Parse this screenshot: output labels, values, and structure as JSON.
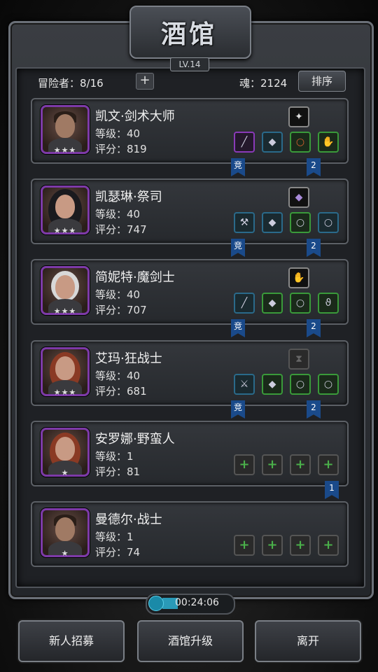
{
  "header": {
    "title": "酒馆",
    "level": "LV.14"
  },
  "topbar": {
    "adventurers": "冒险者：8/16",
    "add": "+",
    "soul": "魂：2124",
    "sort": "排序"
  },
  "heroes": [
    {
      "name": "凯文·剑术大师",
      "level": "等级：40",
      "score": "评分：819",
      "stars": "★★★",
      "ribbon_left": "竞",
      "ribbon_right": "2"
    },
    {
      "name": "凯瑟琳·祭司",
      "level": "等级：40",
      "score": "评分：747",
      "stars": "★★★",
      "ribbon_left": "竞",
      "ribbon_right": "2"
    },
    {
      "name": "简妮特·魔剑士",
      "level": "等级：40",
      "score": "评分：707",
      "stars": "★★★",
      "ribbon_left": "竞",
      "ribbon_right": "2"
    },
    {
      "name": "艾玛·狂战士",
      "level": "等级：40",
      "score": "评分：681",
      "stars": "★★★",
      "ribbon_left": "竞",
      "ribbon_right": "2"
    },
    {
      "name": "安罗娜·野蛮人",
      "level": "等级：1",
      "score": "评分：81",
      "stars": "★",
      "ribbon_right": "1"
    },
    {
      "name": "曼德尔·战士",
      "level": "等级：1",
      "score": "评分：74",
      "stars": "★"
    }
  ],
  "timer": {
    "text": "00:24:06"
  },
  "buttons": {
    "recruit": "新人招募",
    "upgrade": "酒馆升级",
    "leave": "离开"
  }
}
